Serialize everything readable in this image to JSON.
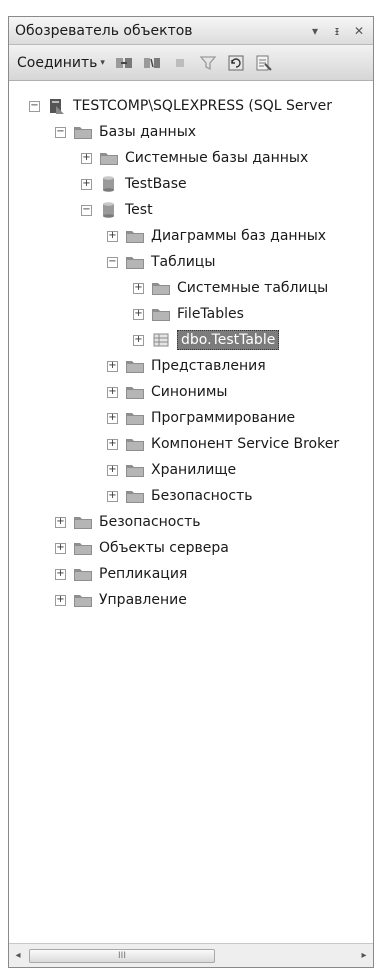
{
  "window": {
    "title": "Обозреватель объектов",
    "controls": {
      "dropdown": "▾",
      "pin": "ᵻ",
      "close": "✕"
    }
  },
  "toolbar": {
    "connect_label": "Соединить",
    "connect_caret": "▾",
    "tools": [
      "connect-object-explorer-icon",
      "disconnect-icon",
      "stop-icon",
      "filter-icon",
      "refresh-icon",
      "summary-icon"
    ]
  },
  "tree": {
    "server": "TESTCOMP\\SQLEXPRESS (SQL Server",
    "databases": "Базы данных",
    "system_databases": "Системные базы данных",
    "testbase": "TestBase",
    "test": "Test",
    "diagrams": "Диаграммы баз данных",
    "tables": "Таблицы",
    "system_tables": "Системные таблицы",
    "filetables": "FileTables",
    "testtable": "dbo.TestTable",
    "views": "Представления",
    "synonyms": "Синонимы",
    "programmability": "Программирование",
    "service_broker": "Компонент Service Broker",
    "storage": "Хранилище",
    "db_security": "Безопасность",
    "security": "Безопасность",
    "server_objects": "Объекты сервера",
    "replication": "Репликация",
    "management": "Управление",
    "expanded_sign": "−",
    "collapsed_sign": "+"
  },
  "scrollbar": {
    "left": "◂",
    "right": "▸",
    "grip": "III"
  }
}
